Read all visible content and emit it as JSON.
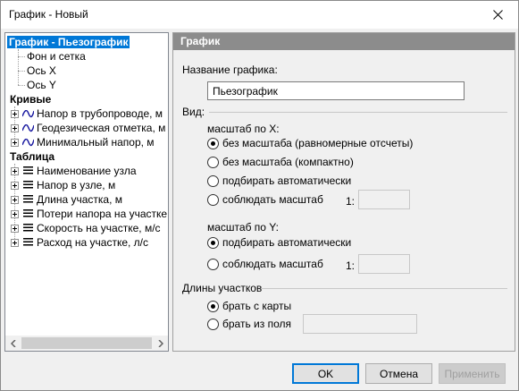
{
  "window": {
    "title": "График - Новый"
  },
  "tree": {
    "root_label": "График - Пьезографик",
    "sub_items": [
      "Фон и сетка",
      "Ось X",
      "Ось Y"
    ],
    "curves_header": "Кривые",
    "curves": [
      "Напор в трубопроводе, м",
      "Геодезическая отметка, м",
      "Минимальный напор, м"
    ],
    "table_header": "Таблица",
    "table_items": [
      "Наименование узла",
      "Напор в узле, м",
      "Длина участка, м",
      "Потери напора на участке",
      "Скорость на участке, м/с",
      "Расход на участке, л/с"
    ]
  },
  "panel": {
    "header": "График",
    "name_label": "Название графика:",
    "name_value": "Пьезографик",
    "view_label": "Вид:",
    "scale_x_label": "масштаб по X:",
    "scale_x_options": [
      "без масштаба (равномерные отсчеты)",
      "без масштаба (компактно)",
      "подбирать автоматически",
      "соблюдать масштаб"
    ],
    "scale_x_ratio_label": "1:",
    "scale_x_ratio_value": "",
    "scale_y_label": "масштаб по Y:",
    "scale_y_options": [
      "подбирать автоматически",
      "соблюдать масштаб"
    ],
    "scale_y_ratio_label": "1:",
    "scale_y_ratio_value": "",
    "lengths_label": "Длины участков",
    "lengths_options": [
      "брать с карты",
      "брать из поля"
    ],
    "lengths_field_value": ""
  },
  "buttons": {
    "ok": "OK",
    "cancel": "Отмена",
    "apply": "Применить"
  },
  "colors": {
    "selection": "#0078d7",
    "panel_header": "#8c8c8c",
    "curve_icon": "#1a1aa0"
  }
}
